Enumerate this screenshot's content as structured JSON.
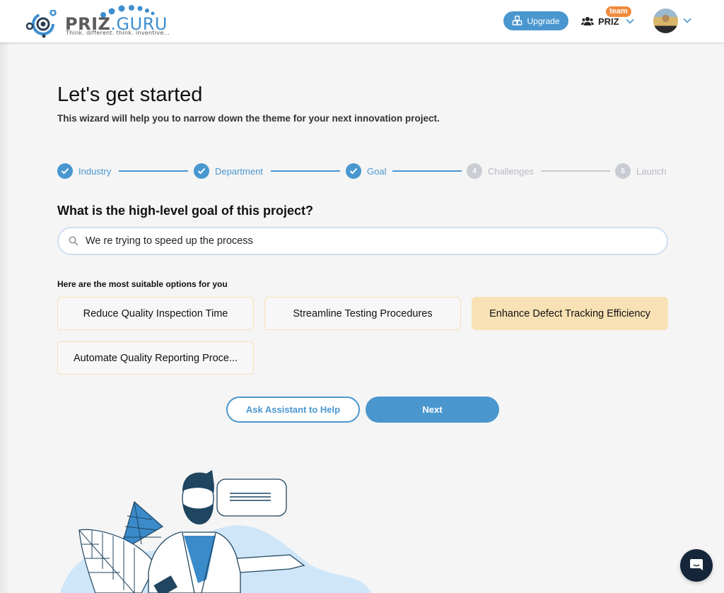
{
  "header": {
    "logo": {
      "brand_part1": "PRIZ",
      "brand_part2": ".GURU",
      "tagline": "Think. different. think. inventive..."
    },
    "upgrade_label": "Upgrade",
    "team": {
      "name": "PRIZ",
      "badge": "team"
    },
    "icons": {
      "upgrade": "cubes-icon",
      "team": "users-icon",
      "chevron": "chevron-down-icon"
    }
  },
  "main": {
    "title": "Let's get started",
    "subtitle": "This wizard will help you to narrow down the theme for your next innovation project.",
    "stepper": {
      "steps": [
        {
          "number": "1",
          "label": "Industry",
          "status": "done"
        },
        {
          "number": "2",
          "label": "Department",
          "status": "done"
        },
        {
          "number": "3",
          "label": "Goal",
          "status": "done"
        },
        {
          "number": "4",
          "label": "Challenges",
          "status": "todo"
        },
        {
          "number": "5",
          "label": "Launch",
          "status": "todo"
        }
      ]
    },
    "question": "What is the high-level goal of this project?",
    "search": {
      "value": "We re trying to speed up the process",
      "placeholder": ""
    },
    "options_label": "Here are the most suitable options for you",
    "options": [
      {
        "label": "Reduce Quality Inspection Time",
        "selected": false
      },
      {
        "label": "Streamline Testing Procedures",
        "selected": false
      },
      {
        "label": "Enhance Defect Tracking Efficiency",
        "selected": true
      },
      {
        "label": "Automate Quality Reporting Proce...",
        "selected": false
      }
    ],
    "buttons": {
      "assistant": "Ask Assistant to Help",
      "next": "Next"
    }
  },
  "colors": {
    "accent": "#4a97cf",
    "inactive": "#c9ccd2",
    "selected_option": "#f8e1b4",
    "badge": "#f08a3c",
    "chat_launcher": "#15253a"
  }
}
